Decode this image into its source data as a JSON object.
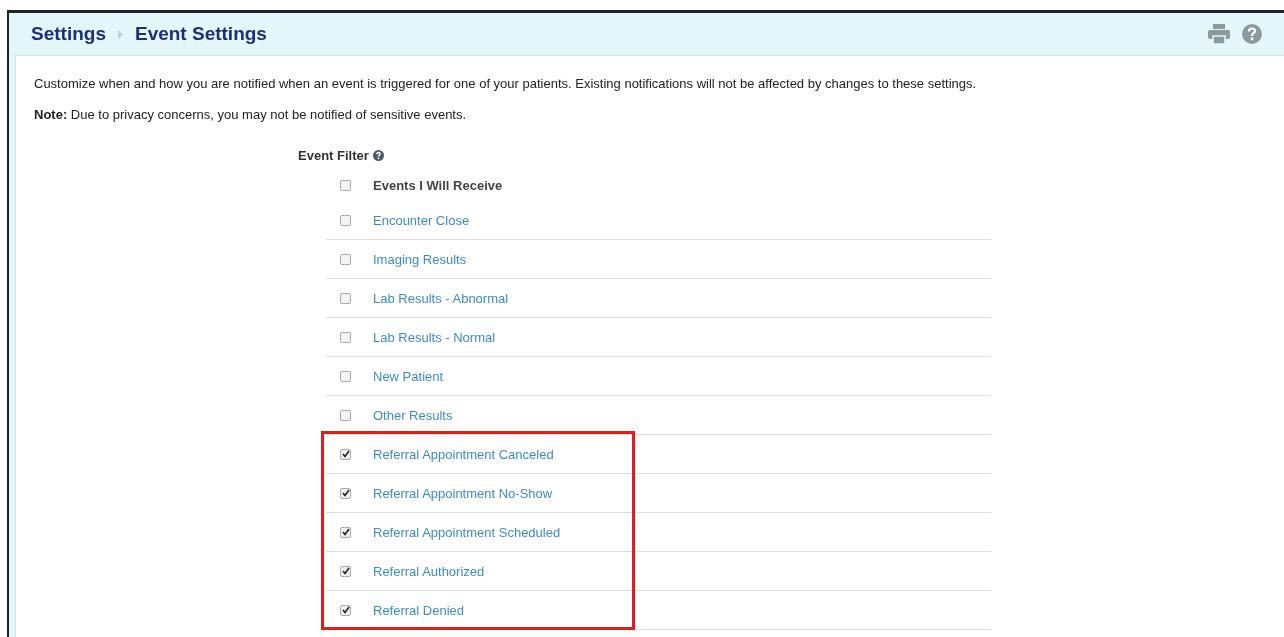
{
  "breadcrumb": [
    "Settings",
    "Event Settings"
  ],
  "description": "Customize when and how you are notified when an event is triggered for one of your patients. Existing notifications will not be affected by changes to these settings.",
  "note": "**Note:** Due to privacy concerns, you may not be notified of sensitive events.",
  "event_filter": {
    "title": "Event Filter",
    "select_all": {
      "label": "Events I Will Receive",
      "checked": false
    },
    "events": [
      {
        "label": "Encounter Close",
        "checked": false,
        "highlighted": false
      },
      {
        "label": "Imaging Results",
        "checked": false,
        "highlighted": false
      },
      {
        "label": "Lab Results - Abnormal",
        "checked": false,
        "highlighted": false
      },
      {
        "label": "Lab Results - Normal",
        "checked": false,
        "highlighted": false
      },
      {
        "label": "New Patient",
        "checked": false,
        "highlighted": false
      },
      {
        "label": "Other Results",
        "checked": false,
        "highlighted": false
      },
      {
        "label": "Referral Appointment Canceled",
        "checked": true,
        "highlighted": true
      },
      {
        "label": "Referral Appointment No-Show",
        "checked": true,
        "highlighted": true
      },
      {
        "label": "Referral Appointment Scheduled",
        "checked": true,
        "highlighted": true
      },
      {
        "label": "Referral Authorized",
        "checked": true,
        "highlighted": true
      },
      {
        "label": "Referral Denied",
        "checked": true,
        "highlighted": true
      }
    ]
  }
}
